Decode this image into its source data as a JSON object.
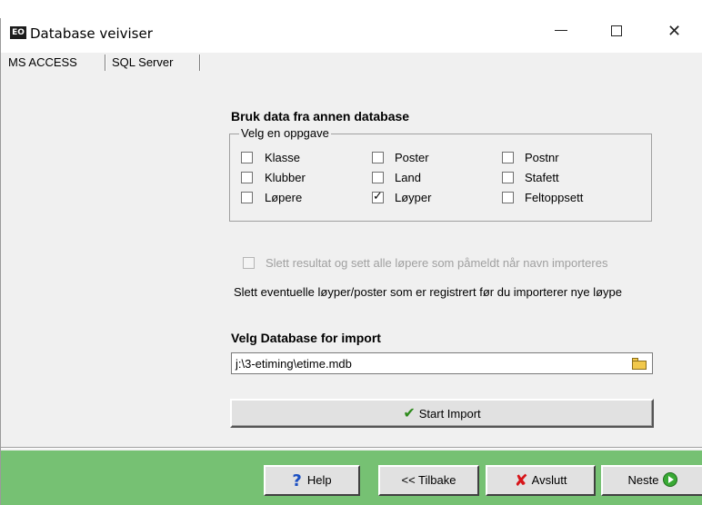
{
  "window": {
    "title": "Database veiviser",
    "icon_text": "EO"
  },
  "tabs": [
    {
      "label": "MS ACCESS"
    },
    {
      "label": "SQL Server"
    }
  ],
  "section": {
    "title": "Bruk data fra annen database",
    "group_label": "Velg en oppgave",
    "checkboxes": [
      {
        "label": "Klasse",
        "checked": false
      },
      {
        "label": "Poster",
        "checked": false
      },
      {
        "label": "Postnr",
        "checked": false
      },
      {
        "label": "Klubber",
        "checked": false
      },
      {
        "label": "Land",
        "checked": false
      },
      {
        "label": "Stafett",
        "checked": false
      },
      {
        "label": "Løpere",
        "checked": false
      },
      {
        "label": "Løyper",
        "checked": true
      },
      {
        "label": "Feltoppsett",
        "checked": false
      }
    ]
  },
  "options": {
    "slett_resultat_label": "Slett resultat og sett alle løpere som påmeldt når navn importeres",
    "info_text": "Slett eventuelle løyper/poster som er registrert før du importerer nye løype"
  },
  "import": {
    "title": "Velg Database for import",
    "path_value": "j:\\3-etiming\\etime.mdb",
    "start_label": "Start Import"
  },
  "footer": {
    "help_label": "Help",
    "back_label": "<< Tilbake",
    "exit_label": "Avslutt",
    "next_label": "Neste"
  },
  "colors": {
    "footer_bg": "#76c173",
    "check_green": "#2d8a1b",
    "exit_red": "#d7151a",
    "help_blue": "#1b4fc2"
  }
}
